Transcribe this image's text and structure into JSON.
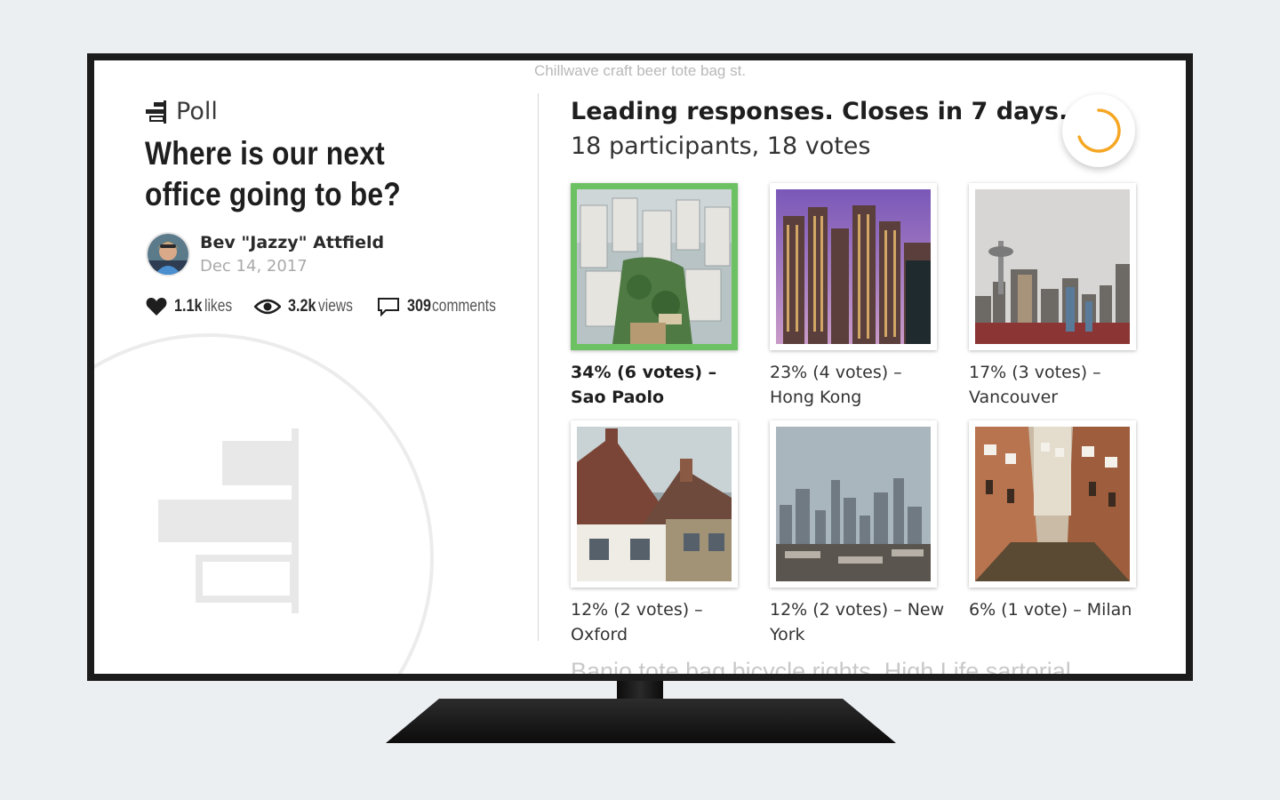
{
  "ticker": {
    "top": "Chillwave craft beer tote bag st.",
    "bottom": "Banjo tote bag bicycle rights, High Life sartorial"
  },
  "poll": {
    "label": "Poll",
    "question": "Where is our next office going to be?",
    "author": "Bev \"Jazzy\" Attfield",
    "date": "Dec 14, 2017",
    "stats": {
      "likes_num": "1.1k",
      "likes_unit": "likes",
      "views_num": "3.2k",
      "views_unit": "views",
      "comments_num": "309",
      "comments_unit": "comments"
    }
  },
  "results": {
    "title": "Leading responses. Closes in 7 days.",
    "subtitle": "18 participants, 18 votes",
    "progress": 0.7,
    "accent_color": "#f5a623",
    "winner_color": "#6cc163",
    "options": [
      {
        "caption": "34% (6 votes) – Sao Paolo",
        "photo": "aerial-city-towers"
      },
      {
        "caption": "23% (4 votes) – Hong Kong",
        "photo": "purple-dusk-skyscrapers"
      },
      {
        "caption": "17% (3 votes) – Vancouver",
        "photo": "tower-skyline"
      },
      {
        "caption": "12% (2 votes) – Oxford",
        "photo": "cottages"
      },
      {
        "caption": "12% (2 votes) – New York",
        "photo": "cloudy-skyline"
      },
      {
        "caption": "6% (1 vote) – Milan",
        "photo": "canal-street"
      }
    ]
  }
}
